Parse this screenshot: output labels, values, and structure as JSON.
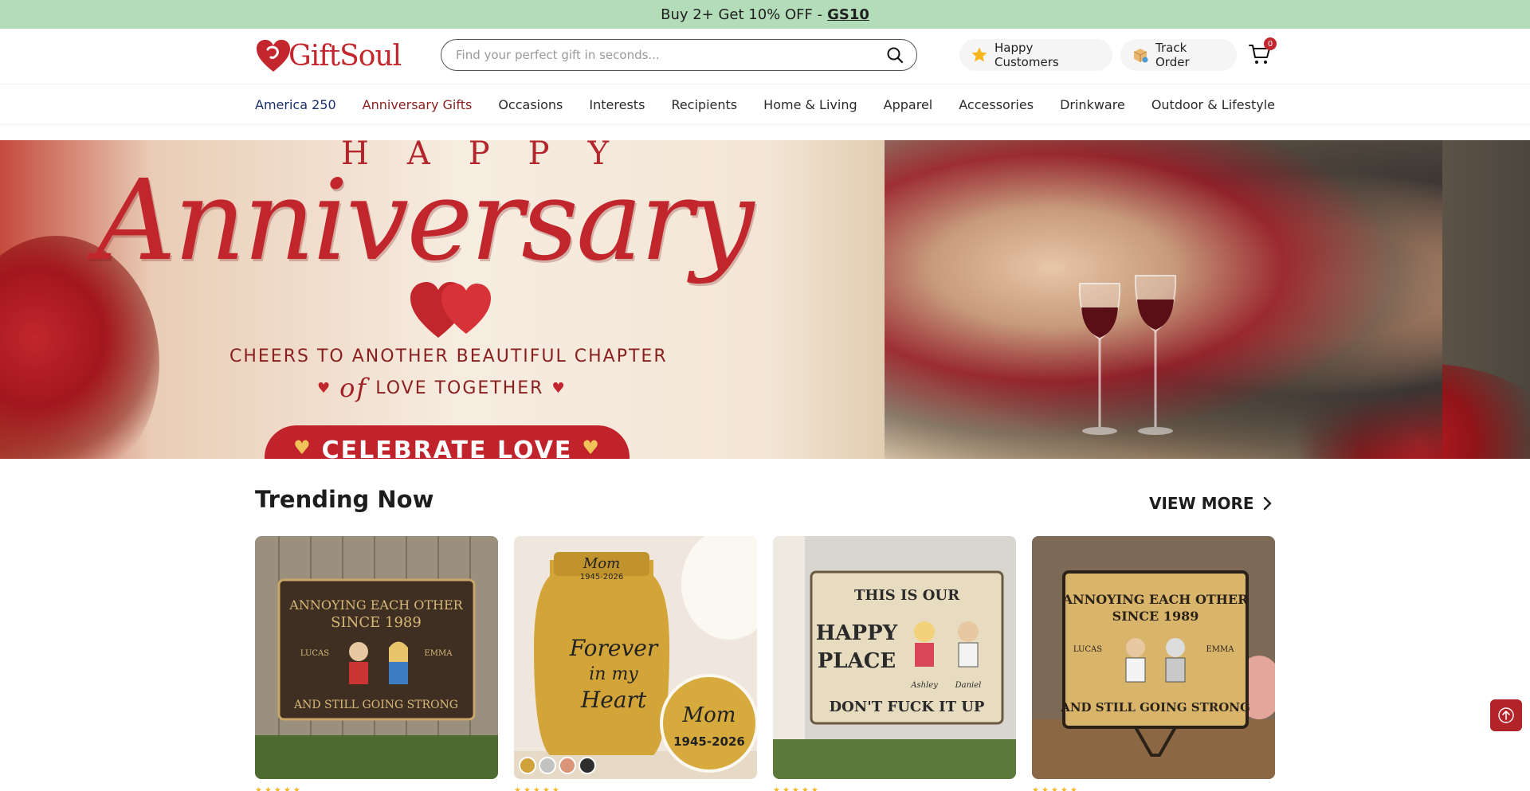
{
  "promo": {
    "text": "Buy 2+ Get 10% OFF -",
    "code": "GS10"
  },
  "header": {
    "logo_text": "GiftSoul",
    "search_placeholder": "Find your perfect gift in seconds...",
    "happy_customers": "Happy Customers",
    "track_order": "Track Order",
    "cart_count": "0"
  },
  "nav": {
    "items": [
      "America 250",
      "Anniversary Gifts",
      "Occasions",
      "Interests",
      "Recipients",
      "Home & Living",
      "Apparel",
      "Accessories",
      "Drinkware",
      "Outdoor & Lifestyle"
    ]
  },
  "hero": {
    "happy": "HAPPY",
    "script": "Anniversary",
    "line1": "CHEERS TO ANOTHER BEAUTIFUL CHAPTER",
    "line2_of": "of",
    "line2": "LOVE TOGETHER",
    "cta": "CELEBRATE LOVE"
  },
  "trending": {
    "title": "Trending Now",
    "view_more": "VIEW MORE",
    "products": [
      {
        "line1": "ANNOYING EACH OTHER",
        "line2": "SINCE 1989",
        "name_left": "LUCAS",
        "name_right": "EMMA",
        "line3": "AND STILL GOING STRONG"
      },
      {
        "top": "Mom",
        "years": "1945-2026",
        "script1": "Forever",
        "script2": "in my",
        "script3": "Heart",
        "disc_name": "Mom",
        "disc_years": "1945-2026"
      },
      {
        "line1": "THIS IS OUR",
        "line2": "HAPPY",
        "line3": "PLACE",
        "name_left": "Ashley",
        "name_right": "Daniel",
        "line4": "DON'T FUCK IT UP"
      },
      {
        "line1": "ANNOYING EACH OTHER",
        "line2": "SINCE 1989",
        "name_left": "LUCAS",
        "name_right": "EMMA",
        "line3": "AND STILL GOING STRONG"
      }
    ],
    "rating_stars": "★★★★★"
  },
  "colors": {
    "promo_bg": "#b2ddb8",
    "brand_red": "#c4262e",
    "nav_america": "#1c2f6e",
    "nav_anniversary": "#8d1e1e"
  }
}
